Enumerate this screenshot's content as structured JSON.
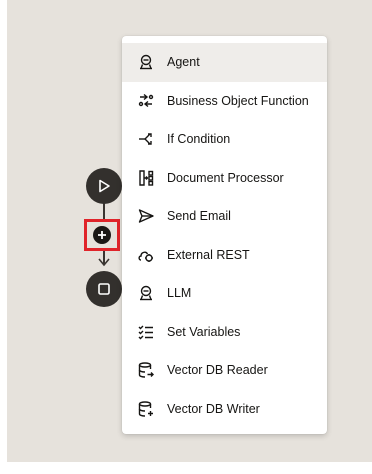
{
  "menu": {
    "items": [
      {
        "label": "Agent",
        "icon": "agent-icon"
      },
      {
        "label": "Business Object Function",
        "icon": "business-object-function-icon"
      },
      {
        "label": "If Condition",
        "icon": "if-condition-icon"
      },
      {
        "label": "Document Processor",
        "icon": "document-processor-icon"
      },
      {
        "label": "Send Email",
        "icon": "send-email-icon"
      },
      {
        "label": "External REST",
        "icon": "external-rest-icon"
      },
      {
        "label": "LLM",
        "icon": "llm-icon"
      },
      {
        "label": "Set Variables",
        "icon": "set-variables-icon"
      },
      {
        "label": "Vector DB Reader",
        "icon": "vector-db-reader-icon"
      },
      {
        "label": "Vector DB Writer",
        "icon": "vector-db-writer-icon"
      }
    ],
    "active_item": "Agent"
  },
  "flow": {
    "start_node_icon": "play-icon",
    "add_step_icon": "plus-icon",
    "end_node_icon": "stop-icon"
  },
  "colors": {
    "canvas": "#e6e2dc",
    "node": "#33302d",
    "highlight": "#e0242a",
    "menu_active": "#efedea"
  }
}
